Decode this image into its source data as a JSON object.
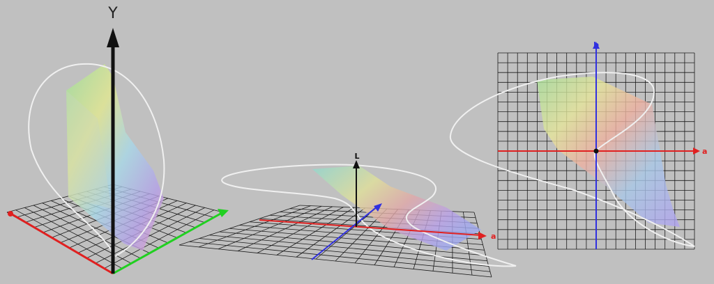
{
  "background": "#c0c0c0",
  "colors": {
    "grid": "#1a1a1a",
    "x_axis": "#e02020",
    "y_axis": "#20d020",
    "z_axis": "#3030e0",
    "vertical_axis": "#111111",
    "locus": "#f0f0f0"
  },
  "views": [
    {
      "id": "xyz-3d",
      "axis_label": "Y"
    },
    {
      "id": "lab-3d",
      "axis_label": "L",
      "a_label": "a"
    },
    {
      "id": "ab-plane",
      "a_label": "a",
      "b_label": "b"
    }
  ]
}
